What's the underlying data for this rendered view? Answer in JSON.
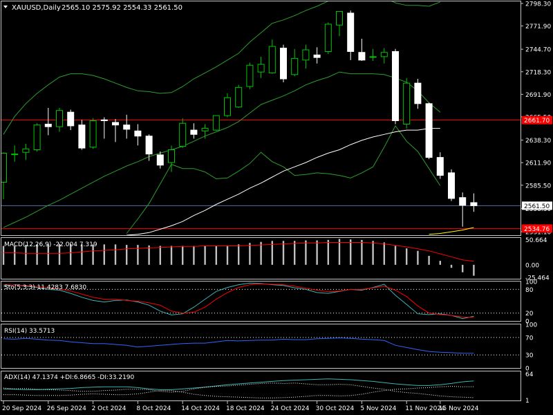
{
  "header": {
    "symbol_label": "XAUUSD,Daily",
    "ohlc_label": "2565.10 2575.92 2554.33 2561.50"
  },
  "colors": {
    "background": "#000000",
    "border": "#c8c8c8",
    "bull_body": "#000000",
    "bear_body": "#ffffff",
    "bull_outline": "#00c800",
    "bear_outline": "#ffffff",
    "band_line": "#2d9e2d",
    "ma_line": "#ffffff",
    "sar_line": "#ffff00",
    "hline_red": "#ff0000",
    "hline_blue": "#5a6ea0",
    "macd_hist": "#c0c0c0",
    "macd_signal": "#ff0000",
    "stoch_main": "#3cb4b4",
    "stoch_signal": "#ff0000",
    "rsi_line": "#3264ff",
    "adx_line": "#3cb4b4",
    "di_dots": "#ffffff",
    "level_dots": "#ffffff"
  },
  "chart_data": [
    {
      "type": "candlestick",
      "title": "XAUUSD,Daily",
      "y_ticks": [
        2798.3,
        2771.9,
        2744.7,
        2718.3,
        2691.9,
        2665.5,
        2638.3,
        2611.9,
        2585.5,
        2558.3,
        2531.1
      ],
      "ylim": [
        2527.0,
        2800.7
      ],
      "price_labels": [
        {
          "value": 2561.5,
          "text": "2561.50",
          "style": "current"
        },
        {
          "value": 2661.7,
          "text": "2661.70",
          "style": "level"
        },
        {
          "value": 2534.76,
          "text": "2534.76",
          "style": "level"
        }
      ],
      "hlines": [
        {
          "value": 2661.7,
          "color": "red"
        },
        {
          "value": 2534.76,
          "color": "red"
        },
        {
          "value": 2561.5,
          "color": "blue"
        }
      ],
      "x_labels": [
        "20 Sep 2024",
        "26 Sep 2024",
        "2 Oct 2024",
        "8 Oct 2024",
        "14 Oct 2024",
        "18 Oct 2024",
        "24 Oct 2024",
        "30 Oct 2024",
        "5 Nov 2024",
        "11 Nov 2024",
        "15 Nov 2024"
      ],
      "x_label_idx": [
        0,
        4,
        8,
        12,
        16,
        20,
        24,
        28,
        32,
        36,
        39
      ],
      "candles": [
        [
          2589.0,
          2624.0,
          2569.0,
          2623.0
        ],
        [
          2622.0,
          2632.0,
          2613.0,
          2622.0
        ],
        [
          2624.0,
          2634.0,
          2615.0,
          2628.0
        ],
        [
          2627.0,
          2658.0,
          2625.0,
          2656.0
        ],
        [
          2657.0,
          2676.0,
          2644.0,
          2654.0
        ],
        [
          2654.0,
          2676.0,
          2648.0,
          2673.0
        ],
        [
          2671.0,
          2674.0,
          2650.0,
          2655.0
        ],
        [
          2656.0,
          2662.0,
          2627.0,
          2629.0
        ],
        [
          2630.0,
          2664.0,
          2628.0,
          2661.0
        ],
        [
          2662.0,
          2665.0,
          2640.0,
          2661.0
        ],
        [
          2659.0,
          2663.0,
          2636.0,
          2656.0
        ],
        [
          2656.0,
          2668.0,
          2640.0,
          2651.0
        ],
        [
          2649.0,
          2657.0,
          2632.0,
          2643.0
        ],
        [
          2643.0,
          2645.0,
          2614.0,
          2622.0
        ],
        [
          2621.0,
          2625.0,
          2605.0,
          2609.0
        ],
        [
          2612.0,
          2632.0,
          2601.0,
          2627.0
        ],
        [
          2631.0,
          2664.0,
          2629.0,
          2658.0
        ],
        [
          2650.0,
          2658.0,
          2640.0,
          2645.0
        ],
        [
          2649.0,
          2657.0,
          2640.0,
          2652.0
        ],
        [
          2650.0,
          2665.0,
          2649.0,
          2667.0
        ],
        [
          2667.0,
          2693.0,
          2665.0,
          2688.0
        ],
        [
          2677.0,
          2703.0,
          2676.0,
          2700.0
        ],
        [
          2701.0,
          2729.0,
          2698.0,
          2726.0
        ],
        [
          2718.0,
          2736.0,
          2711.0,
          2727.0
        ],
        [
          2717.0,
          2756.0,
          2716.0,
          2748.0
        ],
        [
          2746.0,
          2750.0,
          2706.0,
          2710.0
        ],
        [
          2715.0,
          2745.0,
          2713.0,
          2734.0
        ],
        [
          2732.0,
          2750.0,
          2722.0,
          2744.0
        ],
        [
          2738.0,
          2747.0,
          2728.0,
          2735.0
        ],
        [
          2742.0,
          2776.0,
          2739.0,
          2774.0
        ],
        [
          2773.0,
          2789.0,
          2760.0,
          2789.0
        ],
        [
          2787.0,
          2790.0,
          2732.0,
          2742.0
        ],
        [
          2741.0,
          2757.0,
          2731.0,
          2732.0
        ],
        [
          2736.0,
          2745.0,
          2731.0,
          2736.0
        ],
        [
          2736.0,
          2746.0,
          2728.0,
          2741.0
        ],
        [
          2742.0,
          2745.0,
          2657.0,
          2661.0
        ],
        [
          2657.0,
          2711.0,
          2652.0,
          2705.0
        ],
        [
          2705.0,
          2710.0,
          2675.0,
          2681.0
        ],
        [
          2681.0,
          2682.0,
          2616.0,
          2618.0
        ],
        [
          2618.0,
          2624.0,
          2593.0,
          2597.0
        ],
        [
          2600.0,
          2604.0,
          2567.0,
          2570.0
        ],
        [
          2571.0,
          2577.0,
          2537.0,
          2562.0
        ],
        [
          2565.1,
          2575.92,
          2554.33,
          2561.5
        ]
      ],
      "bb_upper": [
        2645,
        2666,
        2681,
        2693,
        2703,
        2712,
        2716,
        2716,
        2714,
        2710,
        2705,
        2700,
        2696,
        2695,
        2693,
        2694,
        2701,
        2710,
        2717,
        2724,
        2732,
        2740,
        2753,
        2764,
        2775,
        2779,
        2784,
        2790,
        2795,
        2801,
        2808,
        2811,
        2811,
        2808,
        2805,
        2799,
        2796,
        2796,
        2795,
        2800,
        null,
        null,
        null
      ],
      "bb_middle": [
        2536,
        2542,
        2548,
        2555,
        2562,
        2568,
        2575,
        2582,
        2589,
        2596,
        2602,
        2608,
        2613,
        2619,
        2623,
        2627,
        2631,
        2637,
        2643,
        2648,
        2653,
        2660,
        2670,
        2680,
        2685,
        2690,
        2696,
        2703,
        2708,
        2712,
        2718,
        2716,
        2716,
        2716,
        2715,
        2711,
        2706,
        2696,
        2682,
        2671,
        null,
        null,
        null
      ],
      "bb_lower": [
        null,
        null,
        null,
        null,
        null,
        null,
        null,
        null,
        null,
        null,
        null,
        2529,
        2546,
        2564,
        2587,
        2610,
        2605,
        2605,
        2601,
        2593,
        2594,
        2602,
        2611,
        2624,
        2613,
        2607,
        2597,
        2598,
        2600,
        2599,
        2597,
        2594,
        2600,
        2607,
        2630,
        2655,
        2637,
        2625,
        2605,
        2585,
        null,
        null,
        null
      ],
      "ma": [
        null,
        null,
        null,
        null,
        null,
        null,
        null,
        null,
        null,
        null,
        null,
        2527,
        2528,
        2530,
        2534,
        2538,
        2543,
        2550,
        2556,
        2563,
        2569,
        2575,
        2582,
        2588,
        2595,
        2602,
        2607,
        2612,
        2618,
        2623,
        2627,
        2633,
        2638,
        2642,
        2645,
        2648,
        2650,
        2650,
        2652,
        2652,
        null,
        null,
        null
      ],
      "sar": [
        null,
        null,
        null,
        null,
        null,
        null,
        null,
        null,
        null,
        null,
        null,
        null,
        null,
        null,
        null,
        null,
        null,
        null,
        null,
        null,
        null,
        null,
        null,
        null,
        null,
        null,
        null,
        null,
        null,
        null,
        null,
        null,
        null,
        null,
        null,
        null,
        null,
        null,
        2528,
        2529,
        2531,
        2533,
        2536
      ]
    },
    {
      "type": "bar",
      "title": "MACD(12,26,9) -22.004 7.319",
      "indicator": "MACD",
      "y_ticks": [
        50.664,
        0.0,
        -25.464
      ],
      "ylim": [
        -28.0,
        54.0
      ],
      "histogram": [
        38,
        38,
        40,
        41,
        41,
        42,
        42,
        41,
        41,
        41,
        41,
        40,
        40,
        39,
        38,
        38,
        38,
        38,
        38,
        38,
        39,
        41,
        44,
        46,
        48,
        48,
        48,
        49,
        49,
        50,
        52,
        51,
        50,
        48,
        45,
        38,
        33,
        28,
        18,
        8,
        -6,
        -15,
        -22
      ],
      "signal": [
        24,
        24,
        23,
        23,
        23,
        23,
        24,
        26,
        28,
        29,
        30,
        32,
        33,
        34,
        35,
        36,
        37,
        37,
        38,
        38,
        38,
        38,
        39,
        40,
        41,
        42,
        43,
        44,
        44,
        45,
        45,
        45,
        45,
        44,
        42,
        39,
        36,
        32,
        28,
        22,
        16,
        10,
        7
      ]
    },
    {
      "type": "line",
      "title": "Sto(5,3,3) 11.4283 7.6830",
      "indicator": "Stochastic",
      "y_ticks": [
        100,
        80,
        20,
        0
      ],
      "levels": [
        80,
        20
      ],
      "ylim": [
        0,
        100
      ],
      "series": [
        {
          "name": "main",
          "values": [
            88,
            92,
            88,
            85,
            80,
            78,
            70,
            60,
            52,
            48,
            52,
            53,
            48,
            40,
            25,
            15,
            18,
            35,
            55,
            75,
            85,
            92,
            96,
            95,
            92,
            90,
            84,
            80,
            72,
            70,
            75,
            80,
            78,
            85,
            93,
            65,
            42,
            18,
            16,
            18,
            14,
            6,
            12
          ]
        },
        {
          "name": "signal",
          "values": [
            92,
            91,
            90,
            87,
            84,
            81,
            76,
            68,
            60,
            55,
            55,
            52,
            50,
            46,
            40,
            25,
            20,
            22,
            35,
            55,
            72,
            85,
            92,
            94,
            93,
            92,
            88,
            83,
            78,
            74,
            76,
            80,
            80,
            84,
            88,
            78,
            62,
            38,
            20,
            16,
            14,
            10,
            9
          ]
        }
      ]
    },
    {
      "type": "line",
      "title": "RSI(14) 33.5713",
      "indicator": "RSI",
      "y_ticks": [
        100,
        70,
        30,
        0
      ],
      "levels": [
        70,
        30
      ],
      "ylim": [
        0,
        100
      ],
      "series": [
        {
          "name": "RSI",
          "values": [
            67,
            66,
            68,
            66,
            64,
            63,
            60,
            58,
            56,
            56,
            54,
            52,
            48,
            50,
            52,
            54,
            56,
            57,
            57,
            60,
            63,
            62,
            63,
            64,
            64,
            66,
            65,
            65,
            67,
            68,
            69,
            68,
            66,
            65,
            63,
            52,
            47,
            42,
            38,
            36,
            35,
            34,
            33.6
          ]
        }
      ]
    },
    {
      "type": "line",
      "title": "ADX(14) 47.1374 +DI:6.8665 -DI:33.2190",
      "indicator": "ADX",
      "y_ticks": [
        64,
        1
      ],
      "ylim": [
        0,
        70
      ],
      "series": [
        {
          "name": "ADX",
          "values": [
            28,
            27,
            26,
            26,
            27,
            28,
            29,
            31,
            32,
            33,
            33,
            33,
            31,
            28,
            26,
            26,
            28,
            30,
            32,
            35,
            38,
            40,
            42,
            44,
            46,
            48,
            49,
            50,
            51,
            52,
            51,
            50,
            48,
            46,
            43,
            40,
            38,
            36,
            36,
            38,
            41,
            45,
            47.1
          ]
        },
        {
          "name": "+DI",
          "values": [
            30,
            28,
            29,
            27,
            26,
            25,
            24,
            22,
            22,
            24,
            25,
            27,
            27,
            26,
            22,
            20,
            22,
            28,
            32,
            34,
            35,
            37,
            39,
            41,
            42,
            41,
            42,
            40,
            38,
            38,
            39,
            38,
            34,
            30,
            27,
            22,
            19,
            17,
            14,
            11,
            9,
            8,
            6.9
          ]
        },
        {
          "name": "-DI",
          "values": [
            14,
            14,
            13,
            12,
            12,
            12,
            13,
            15,
            16,
            15,
            14,
            14,
            16,
            20,
            24,
            24,
            20,
            15,
            12,
            10,
            9,
            8,
            7,
            6,
            6,
            7,
            8,
            10,
            12,
            12,
            11,
            12,
            15,
            20,
            24,
            27,
            28,
            30,
            31,
            33,
            34,
            33,
            33.2
          ]
        }
      ]
    }
  ]
}
